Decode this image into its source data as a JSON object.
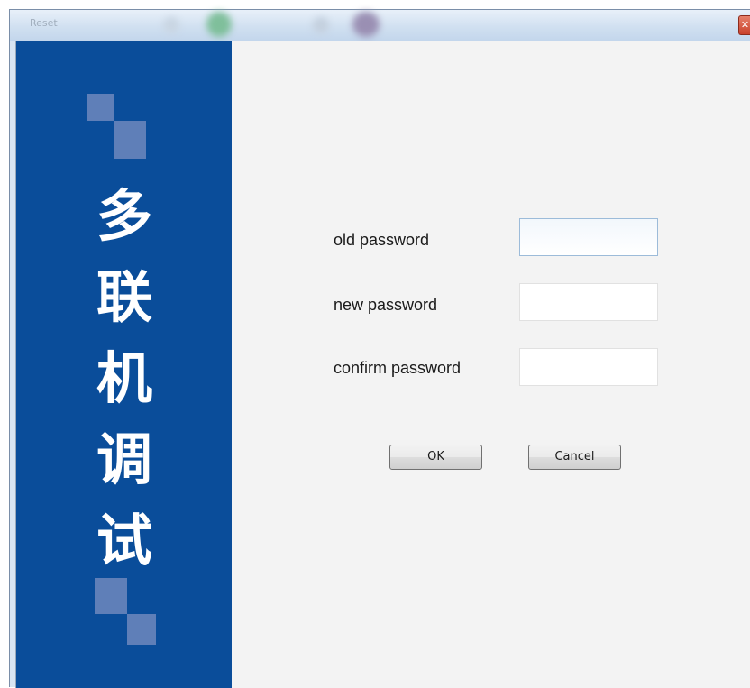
{
  "window": {
    "title": "Reset",
    "close_glyph": "✕"
  },
  "side_panel": {
    "title_chars": [
      "多",
      "联",
      "机",
      "调",
      "试"
    ],
    "colors": {
      "background": "#0a4d9a",
      "squares": "#5f7fb8"
    }
  },
  "form": {
    "old_password": {
      "label": "old password",
      "value": "",
      "placeholder": ""
    },
    "new_password": {
      "label": "new password",
      "value": "",
      "placeholder": ""
    },
    "confirm_password": {
      "label": "confirm password",
      "value": "",
      "placeholder": ""
    },
    "ok_label": "OK",
    "cancel_label": "Cancel"
  },
  "icons": [
    "close-icon"
  ]
}
